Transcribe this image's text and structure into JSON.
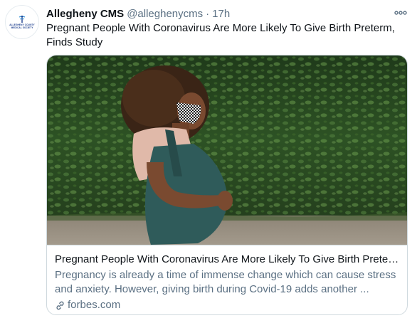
{
  "tweet": {
    "avatar": {
      "icon": "allegheny-county-medical-society-logo",
      "logo_text": "ALLEGHENY COUNTY MEDICAL SOCIETY"
    },
    "display_name": "Allegheny CMS",
    "handle": "@alleghenycms",
    "separator": "·",
    "time": "17h",
    "more_icon": "more-dots-icon",
    "text": "Pregnant People With Coronavirus Are More Likely To Give Birth Preterm, Finds Study",
    "card": {
      "image_description": "photo-pregnant-woman-in-mask",
      "title": "Pregnant People With Coronavirus Are More Likely To Give Birth Preter...",
      "description": "Pregnancy is already a time of immense change which can cause stress and anxiety. However, giving birth during Covid-19 adds another ...",
      "domain": "forbes.com",
      "domain_icon": "link-icon"
    }
  },
  "colors": {
    "primary_text": "#0f1419",
    "secondary_text": "#5b7083",
    "border": "#cfd9de",
    "brand": "#1d3f8f"
  }
}
